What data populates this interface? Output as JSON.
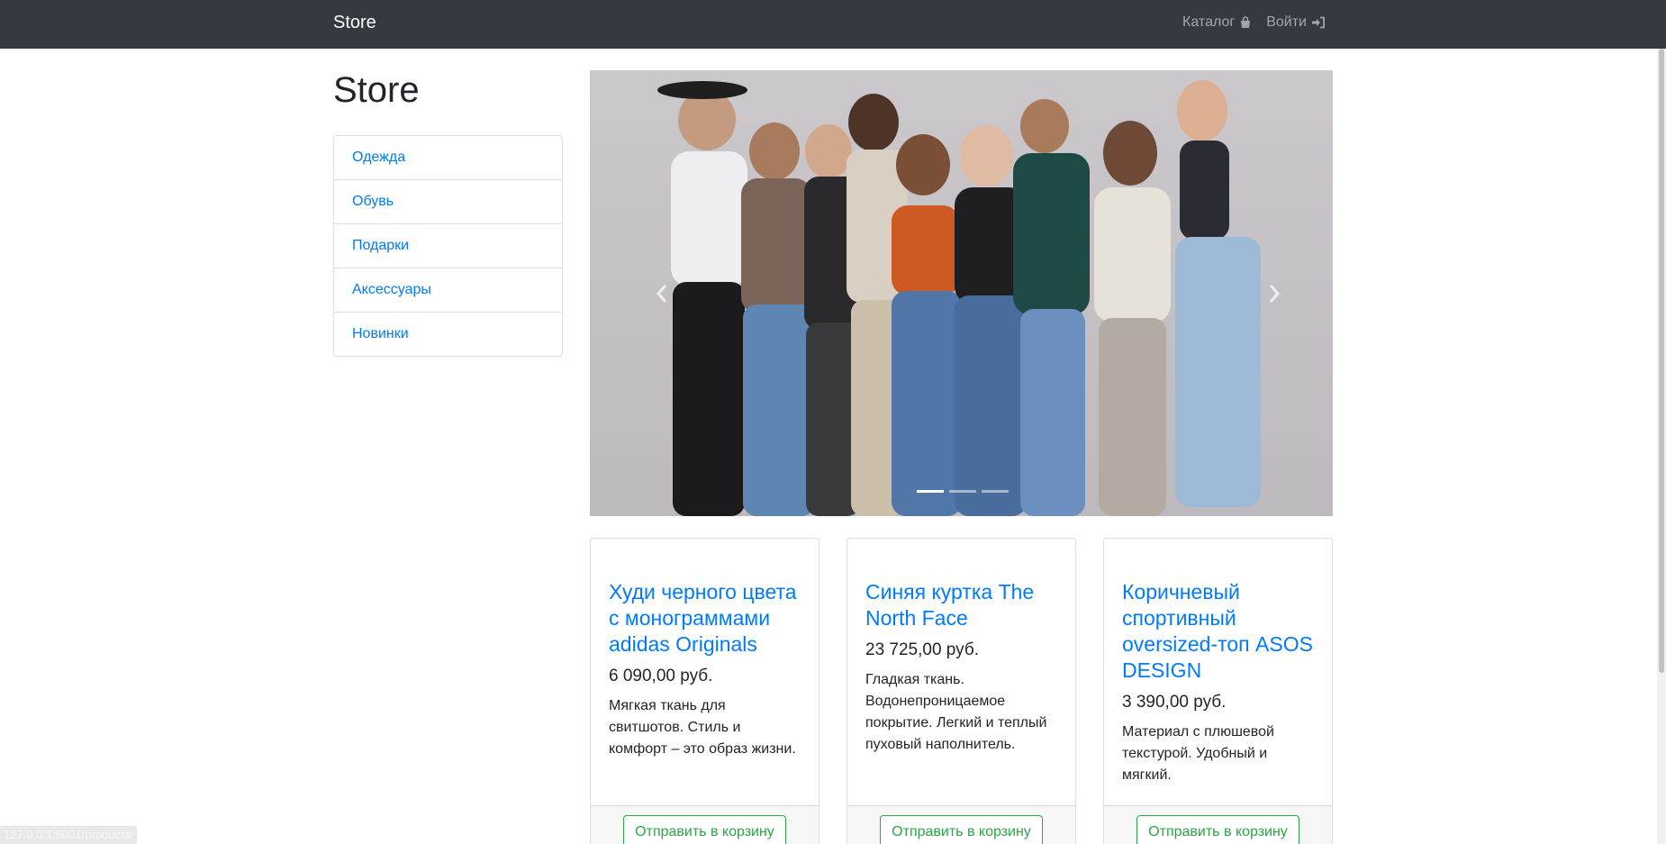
{
  "navbar": {
    "brand": "Store",
    "catalog_label": "Каталог",
    "catalog_icon": "shopping-bag-icon",
    "login_label": "Войти",
    "login_icon": "sign-in-icon"
  },
  "page_title": "Store",
  "categories": [
    {
      "label": "Одежда"
    },
    {
      "label": "Обувь"
    },
    {
      "label": "Подарки"
    },
    {
      "label": "Аксессуары"
    },
    {
      "label": "Новинки"
    }
  ],
  "carousel": {
    "slide_count": 3,
    "active_slide": 1
  },
  "products": [
    {
      "title": "Худи черного цвета с монограммами adidas Originals",
      "price": "6 090,00 руб.",
      "description": "Мягкая ткань для свитшотов. Стиль и комфорт – это образ жизни.",
      "button_label": "Отправить в корзину"
    },
    {
      "title": "Синяя куртка The North Face",
      "price": "23 725,00 руб.",
      "description": "Гладкая ткань. Водонепроницаемое покрытие. Легкий и теплый пуховый наполнитель.",
      "button_label": "Отправить в корзину"
    },
    {
      "title": "Коричневый спортивный oversized-топ ASOS DESIGN",
      "price": "3 390,00 руб.",
      "description": "Материал с плюшевой текстурой. Удобный и мягкий.",
      "button_label": "Отправить в корзину"
    }
  ],
  "status_url": "127.0.0.1:8001/products/",
  "colors": {
    "navbar_bg": "#343a40",
    "link": "#007bff",
    "success": "#28a745"
  }
}
